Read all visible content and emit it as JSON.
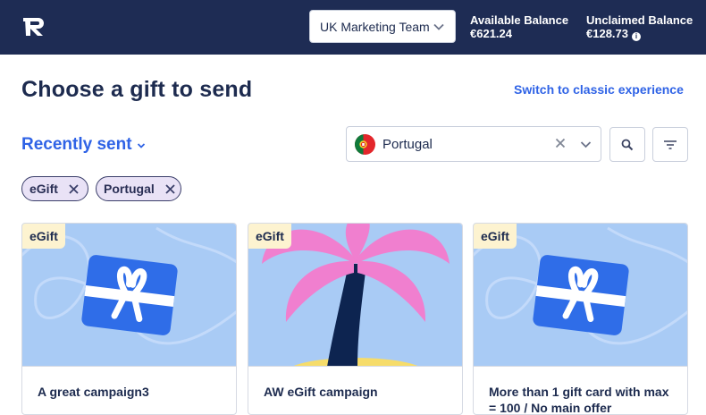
{
  "header": {
    "logo_icon": "gift-r-logo-icon",
    "team_select": {
      "selected": "UK Marketing Team"
    },
    "available_balance": {
      "label": "Available Balance",
      "value": "€621.24"
    },
    "unclaimed_balance": {
      "label": "Unclaimed Balance",
      "value": "€128.73"
    }
  },
  "main": {
    "title": "Choose a gift to send",
    "classic_link": "Switch to classic experience",
    "sort_label": "Recently sent",
    "country_filter": {
      "value": "Portugal",
      "flag": "portugal-flag-icon"
    },
    "chips": [
      {
        "label": "eGift"
      },
      {
        "label": "Portugal"
      }
    ],
    "cards": [
      {
        "badge": "eGift",
        "title": "A great campaign3",
        "image": "gift-card-icon"
      },
      {
        "badge": "eGift",
        "title": "AW eGift campaign",
        "image": "palm-tree-icon"
      },
      {
        "badge": "eGift",
        "title": "More than 1 gift card with max = 100 / No main offer",
        "image": "gift-card-icon"
      }
    ]
  },
  "colors": {
    "header_bg": "#1e2c54",
    "accent": "#2f63e6",
    "card_image_bg": "#a9cbf5",
    "chip_bg": "#e9e2f6",
    "badge_bg": "#fdf3d0",
    "palm_leaves": "#f07fcf",
    "palm_trunk": "#0d2450"
  }
}
